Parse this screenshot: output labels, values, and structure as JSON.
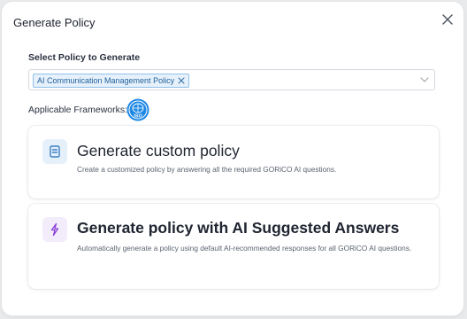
{
  "dialog": {
    "title": "Generate Policy",
    "close_icon": "close-icon"
  },
  "policy_select": {
    "label": "Select Policy to Generate",
    "selected_tags": [
      "AI Communication Management Policy"
    ],
    "remove_icon": "x-icon",
    "dropdown_icon": "chevron-down-icon"
  },
  "frameworks": {
    "label": "Applicable Frameworks:",
    "badges": [
      {
        "icon": "iso-badge-icon",
        "text": "ISO",
        "color": "#1e88e5"
      }
    ]
  },
  "options": [
    {
      "icon": "document-icon",
      "icon_color": "#3b7fc4",
      "title": "Generate custom policy",
      "description": "Create a customized policy by answering all the required GORiCO AI questions."
    },
    {
      "icon": "lightning-icon",
      "icon_color": "#8b3fd6",
      "title": "Generate policy with AI Suggested Answers",
      "description": "Automatically generate a policy using default AI-recommended responses for all GORiCO AI questions."
    }
  ]
}
